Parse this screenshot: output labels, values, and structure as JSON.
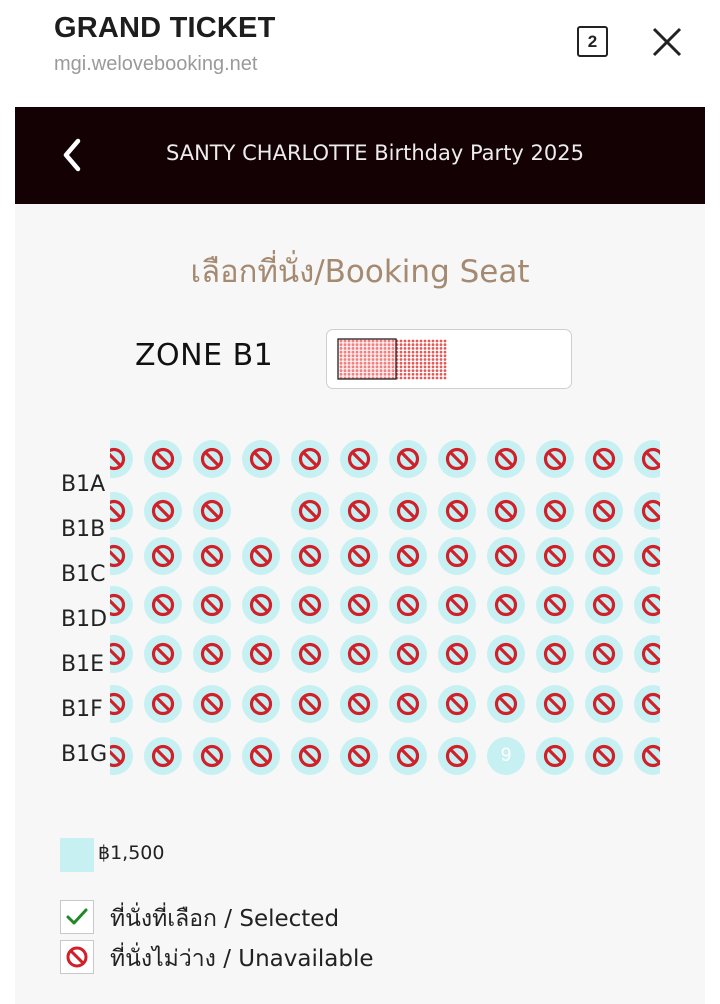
{
  "browser": {
    "title": "GRAND TICKET",
    "url": "mgi.welovebooking.net",
    "tab_count": "2"
  },
  "event": {
    "title": "SANTY CHARLOTTE Birthday Party 2025"
  },
  "booking": {
    "heading": "เลือกที่นั่ง/Booking Seat",
    "zone_label": "ZONE B1"
  },
  "seat_map": {
    "rows": [
      {
        "label": "B1A",
        "seats": [
          "u",
          "u",
          "u",
          "u",
          "u",
          "u",
          "u",
          "u",
          "u",
          "u",
          "u",
          "u"
        ]
      },
      {
        "label": "B1B",
        "seats": [
          "u",
          "u",
          "u",
          "",
          "u",
          "u",
          "u",
          "u",
          "u",
          "u",
          "u",
          "u"
        ]
      },
      {
        "label": "B1C",
        "seats": [
          "u",
          "u",
          "u",
          "u",
          "u",
          "u",
          "u",
          "u",
          "u",
          "u",
          "u",
          "u"
        ]
      },
      {
        "label": "B1D",
        "seats": [
          "u",
          "u",
          "u",
          "u",
          "u",
          "u",
          "u",
          "u",
          "u",
          "u",
          "u",
          "u"
        ]
      },
      {
        "label": "B1E",
        "seats": [
          "u",
          "u",
          "u",
          "u",
          "u",
          "u",
          "u",
          "u",
          "u",
          "u",
          "u",
          "u"
        ]
      },
      {
        "label": "B1F",
        "seats": [
          "u",
          "u",
          "u",
          "u",
          "u",
          "u",
          "u",
          "u",
          "u",
          "u",
          "u",
          "u"
        ]
      },
      {
        "label": "B1G",
        "seats": [
          "u",
          "u",
          "u",
          "u",
          "u",
          "u",
          "u",
          "u",
          "9",
          "u",
          "u",
          "u"
        ]
      }
    ],
    "seat_color": "#c7f0f2",
    "unavailable_color": "#d0202a"
  },
  "legend": {
    "price": "฿1,500",
    "selected": "ที่นั่งที่เลือก / Selected",
    "unavailable": "ที่นั่งไม่ว่าง / Unavailable"
  },
  "icons": {
    "close": "close-icon",
    "back": "chevron-left-icon",
    "unavailable": "no-entry-icon",
    "selected": "check-icon"
  }
}
